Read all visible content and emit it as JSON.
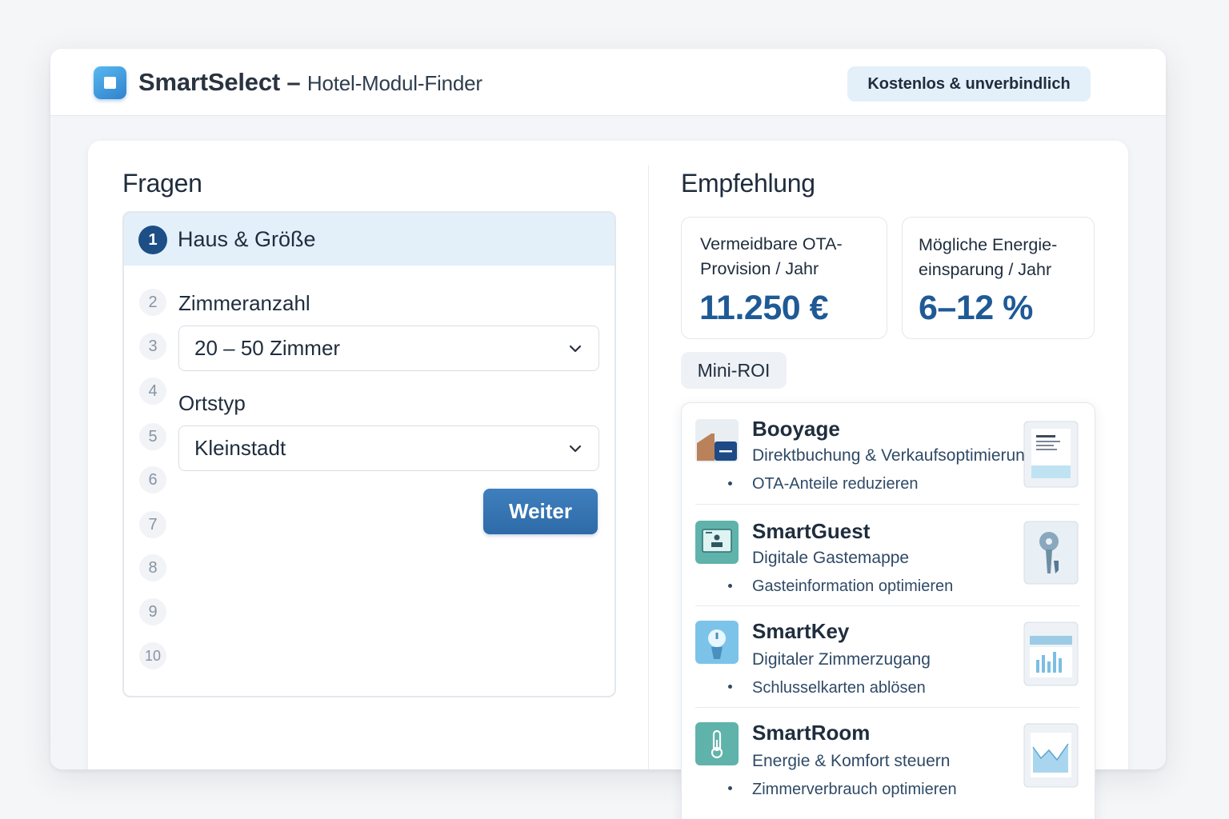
{
  "header": {
    "brand": "SmartSelect",
    "separator": " – ",
    "subtitle": "Hotel-Modul-Finder",
    "badge": "Kostenlos & unverbindlich"
  },
  "questions": {
    "title": "Fragen",
    "active_step": {
      "number": "1",
      "label": "Haus & Größe"
    },
    "steps": [
      "2",
      "3",
      "4",
      "5",
      "6",
      "7",
      "8",
      "9",
      "10"
    ],
    "room_count_label": "Zimmeranzahl",
    "room_count_value": "20 – 50 Zimmer",
    "location_label": "Ortstyp",
    "location_value": "Kleinstadt",
    "next_button": "Weiter"
  },
  "recommendation": {
    "title": "Empfehlung",
    "stats": [
      {
        "label_line1": "Vermeidbare OTA-",
        "label_line2": "Provision / Jahr",
        "value": "11.250 €"
      },
      {
        "label_line1": "Mögliche Energie-",
        "label_line2": "einsparung / Jahr",
        "value": "6–12 %"
      }
    ],
    "mini_roi_label": "Mini-ROI",
    "modules": [
      {
        "name": "Booyage",
        "description": "Direktbuchung & Verkaufsoptimierung",
        "benefit": "OTA-Anteile reduzieren",
        "icon": "booking-icon",
        "thumbnail": "document-chart-thumbnail"
      },
      {
        "name": "SmartGuest",
        "description": "Digitale Gastemappe",
        "benefit": "Gasteinformation optimieren",
        "icon": "guest-folder-icon",
        "thumbnail": "key-thumbnail"
      },
      {
        "name": "SmartKey",
        "description": "Digitaler Zimmerzugang",
        "benefit": "Schlusselkarten ablösen",
        "icon": "digital-key-icon",
        "thumbnail": "bar-chart-thumbnail"
      },
      {
        "name": "SmartRoom",
        "description": "Energie & Komfort steuern",
        "benefit": "Zimmerverbrauch optimieren",
        "icon": "thermometer-icon",
        "thumbnail": "area-chart-thumbnail"
      }
    ]
  },
  "colors": {
    "accent": "#1f5a96",
    "primary_button": "#3a78b7",
    "highlight_bg": "#e3f0fa",
    "step_active": "#1d4f86"
  }
}
